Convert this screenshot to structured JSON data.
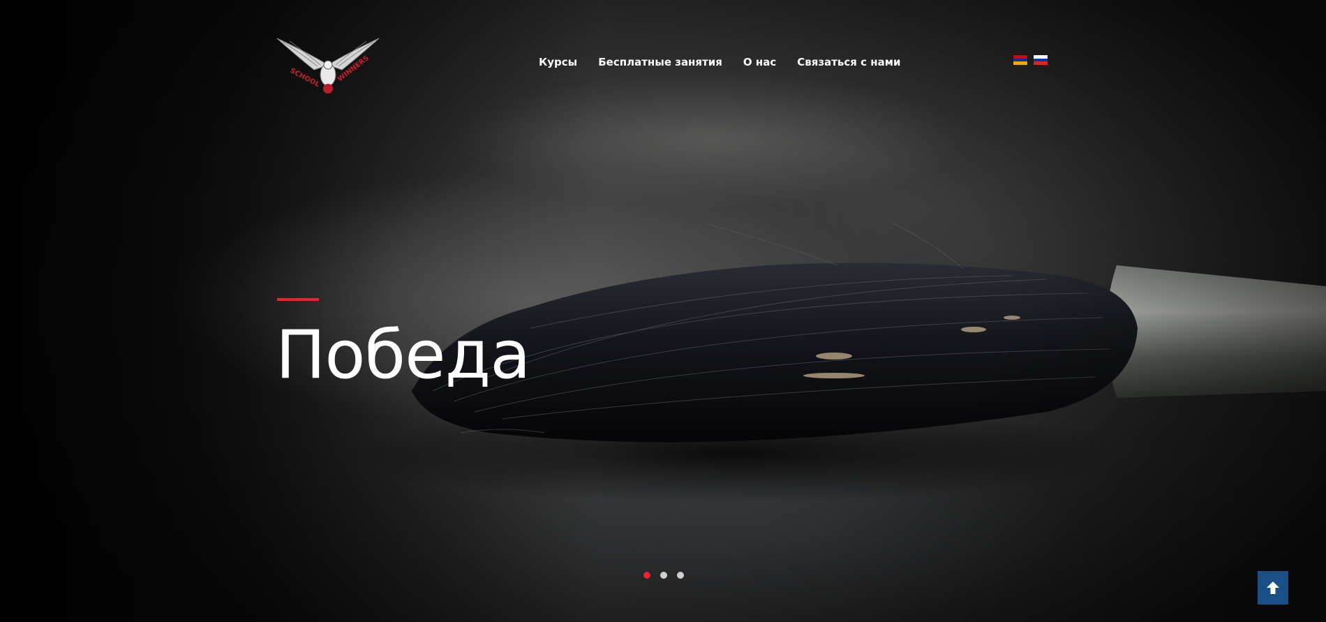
{
  "brand": {
    "logo_text_left": "SCHOOL",
    "logo_text_right": "WINNERS",
    "logo_icon": "eagle-logo-icon"
  },
  "nav": {
    "items": [
      {
        "label": "Курсы"
      },
      {
        "label": "Бесплатные занятия"
      },
      {
        "label": "О нас"
      },
      {
        "label": "Связаться с нами"
      }
    ]
  },
  "languages": [
    {
      "icon": "flag-armenia-icon",
      "colors": [
        "#d90012",
        "#0033a0",
        "#f2a800"
      ]
    },
    {
      "icon": "flag-russia-icon",
      "colors": [
        "#ffffff",
        "#0039a6",
        "#d52b1e"
      ]
    }
  ],
  "hero": {
    "title": "Победа",
    "accent_color": "#e8232f"
  },
  "slider": {
    "slide_count": 3,
    "active_index": 0
  },
  "scroll_top": {
    "icon": "arrow-up-icon",
    "color": "#1a4f86"
  }
}
